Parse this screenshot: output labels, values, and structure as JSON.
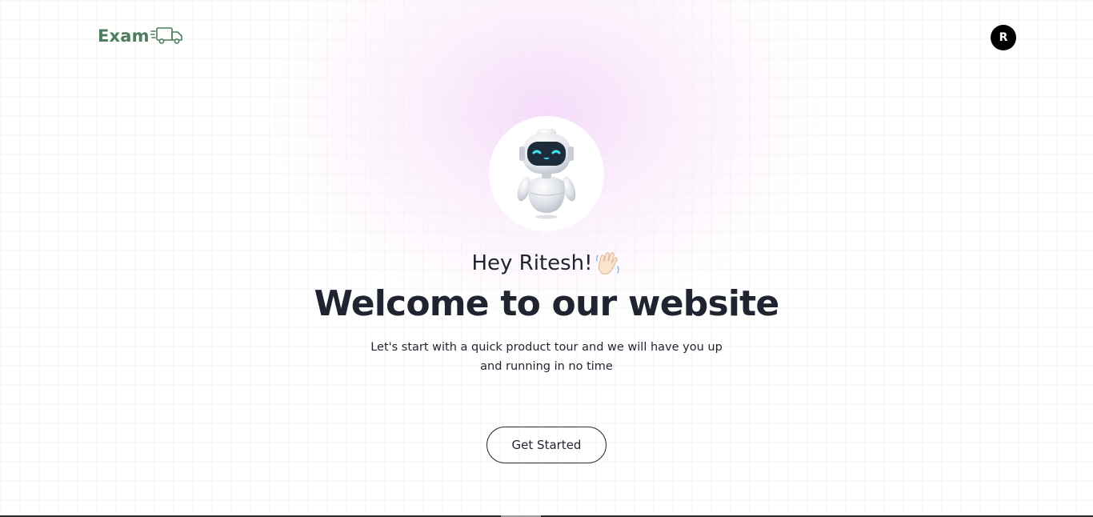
{
  "header": {
    "logo_text": "Exam",
    "logo_icon": "delivery-truck-icon",
    "avatar_initial": "R"
  },
  "hero": {
    "robot_icon": "robot-mascot-icon",
    "greeting": "Hey Ritesh!",
    "greeting_icon": "waving-hand-icon",
    "title": "Welcome to our website",
    "subtitle": "Let's start with a quick product tour and we will have you up and running in no time",
    "cta_label": "Get Started"
  },
  "colors": {
    "logo": "#4d7d5c",
    "text": "#1f2430",
    "avatar_bg": "#000000",
    "glow": "#f4d6f8",
    "robot_visor": "#1e2b3a",
    "robot_eyes": "#3fe0f0"
  }
}
